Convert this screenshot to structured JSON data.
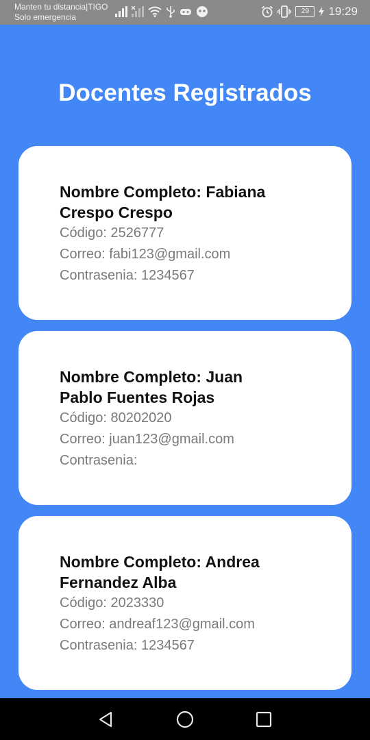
{
  "status_bar": {
    "carrier_line1": "Manten tu distancia|TIGO",
    "carrier_line2": "Solo emergencia",
    "battery": "29",
    "time": "19:29"
  },
  "title": "Docentes Registrados",
  "docentes": [
    {
      "name": "Nombre Completo: Fabiana Crespo Crespo",
      "codigo": "Código: 2526777",
      "correo": "Correo: fabi123@gmail.com",
      "contrasenia": "Contrasenia: 1234567"
    },
    {
      "name": "Nombre Completo: Juan Pablo Fuentes Rojas",
      "codigo": "Código: 80202020",
      "correo": "Correo: juan123@gmail.com",
      "contrasenia": "Contrasenia:"
    },
    {
      "name": "Nombre Completo: Andrea Fernandez Alba",
      "codigo": "Código: 2023330",
      "correo": "Correo: andreaf123@gmail.com",
      "contrasenia": "Contrasenia: 1234567"
    }
  ],
  "colors": {
    "background": "#4287f5",
    "card": "#ffffff",
    "status_bar": "#8a8a8a",
    "nav_bar": "#000000"
  },
  "icons": {
    "status_left": [
      "signal-icon",
      "signal-off-icon",
      "wifi-icon",
      "usb-icon",
      "game-icon",
      "app-icon"
    ],
    "status_right": [
      "alarm-icon",
      "vibrate-icon",
      "battery-icon",
      "charging-icon"
    ],
    "navigation": [
      "back-icon",
      "home-icon",
      "recents-icon"
    ]
  }
}
